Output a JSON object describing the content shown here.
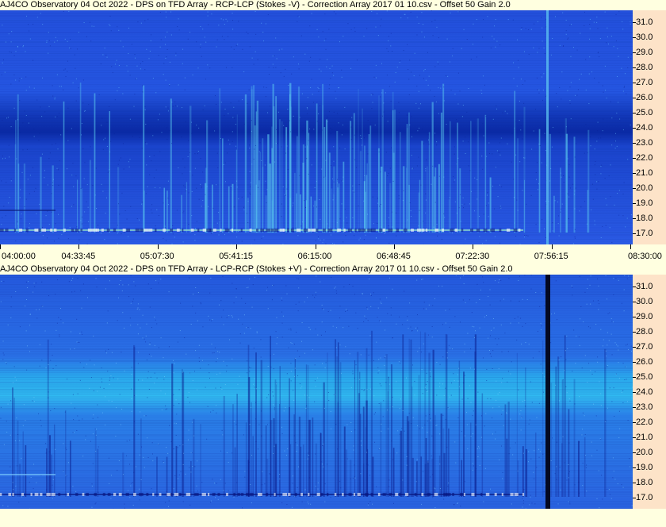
{
  "chart_data": [
    {
      "type": "heatmap",
      "title": "AJ4CO Observatory 04 Oct 2022  -  DPS on TFD Array  -  RCP-LCP (Stokes -V)  -  Correction Array 2017 01 10.csv  -  Offset 50  Gain 2.0",
      "y_ticks": [
        "31.0",
        "30.0",
        "29.0",
        "28.0",
        "27.0",
        "26.0",
        "25.0",
        "24.0",
        "23.0",
        "22.0",
        "21.0",
        "20.0",
        "19.0",
        "18.0",
        "17.0"
      ],
      "x_ticks": [
        "04:00:00",
        "04:33:45",
        "05:07:30",
        "05:41:15",
        "06:15:00",
        "06:48:45",
        "07:22:30",
        "07:56:15",
        "08:30:00"
      ],
      "ylim": [
        16.3,
        31.8
      ],
      "colors": {
        "base": "#1e48d6",
        "dark_band": "#0a2aa4",
        "streak": "#5fd2f0"
      }
    },
    {
      "type": "heatmap",
      "title": "AJ4CO Observatory 04 Oct 2022  -  DPS on TFD Array  -  LCP-RCP (Stokes +V)  -  Correction Array 2017 01 10.csv  -  Offset 50  Gain 2.0",
      "y_ticks": [
        "31.0",
        "30.0",
        "29.0",
        "28.0",
        "27.0",
        "26.0",
        "25.0",
        "24.0",
        "23.0",
        "22.0",
        "21.0",
        "20.0",
        "19.0",
        "18.0",
        "17.0"
      ],
      "ylim": [
        16.3,
        31.8
      ],
      "colors": {
        "base": "#2a66e4",
        "light_band": "#2fb8ee",
        "streak": "#0a1c8c"
      }
    }
  ]
}
